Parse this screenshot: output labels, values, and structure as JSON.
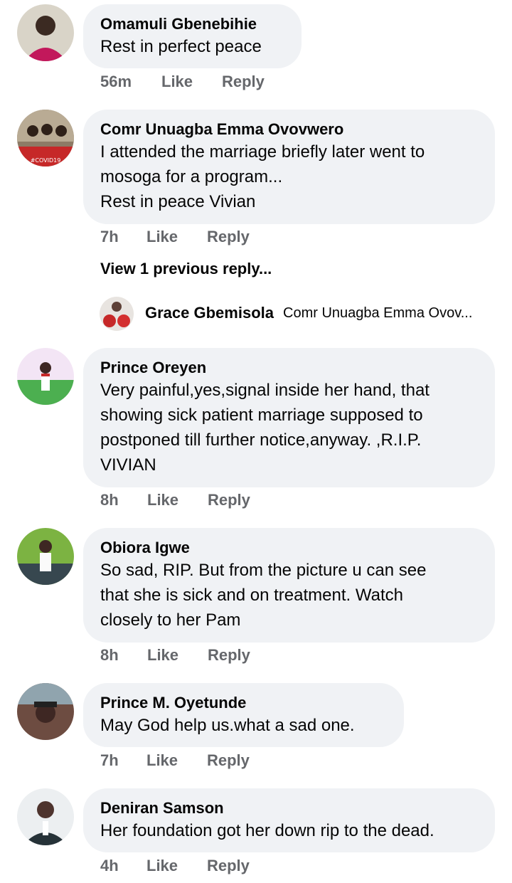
{
  "comments": [
    {
      "author": "Omamuli Gbenebihie",
      "lines": [
        "Rest in perfect peace"
      ],
      "time": "56m",
      "like_label": "Like",
      "reply_label": "Reply"
    },
    {
      "author": "Comr Unuagba Emma Ovovwero",
      "lines": [
        "I attended the marriage briefly later went to",
        "mosoga for a program...",
        "Rest in peace Vivian"
      ],
      "time": "7h",
      "like_label": "Like",
      "reply_label": "Reply",
      "view_previous": "View 1 previous reply...",
      "reply_preview": {
        "name": "Grace Gbemisola",
        "snippet": "Comr Unuagba Emma Ovov..."
      }
    },
    {
      "author": "Prince Oreyen",
      "lines": [
        "Very painful,yes,signal inside her hand, that",
        "showing sick patient marriage supposed to",
        "postponed till further notice,anyway. ,R.I.P.",
        "VIVIAN"
      ],
      "time": "8h",
      "like_label": "Like",
      "reply_label": "Reply"
    },
    {
      "author": "Obiora Igwe",
      "lines": [
        "So sad, RIP. But from the picture u can see",
        "that she is sick and on treatment. Watch",
        "closely to her Pam"
      ],
      "time": "8h",
      "like_label": "Like",
      "reply_label": "Reply"
    },
    {
      "author": "Prince M. Oyetunde",
      "lines": [
        "May God help us.what a sad one."
      ],
      "time": "7h",
      "like_label": "Like",
      "reply_label": "Reply"
    },
    {
      "author": "Deniran Samson",
      "lines": [
        "Her foundation got her down rip to the dead."
      ],
      "time": "4h",
      "like_label": "Like",
      "reply_label": "Reply"
    }
  ],
  "avatar_thumbnail_text": "#COVID19",
  "colors": {
    "bubble_bg": "#f0f2f5",
    "meta_text": "#65676b",
    "primary_text": "#050505"
  }
}
